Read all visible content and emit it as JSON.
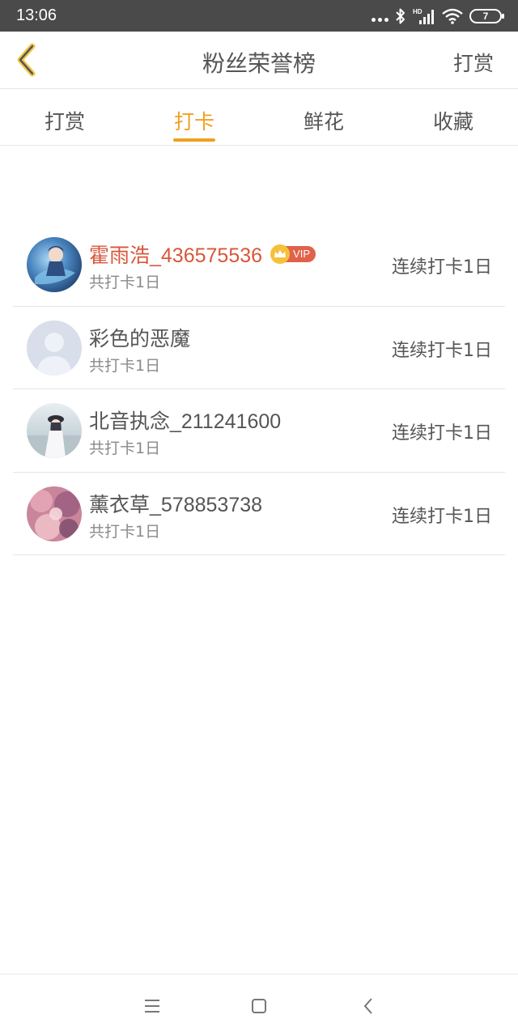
{
  "status_bar": {
    "time": "13:06",
    "battery": "7",
    "icons": [
      "more-dots-icon",
      "bluetooth-icon",
      "signal-hd-icon",
      "wifi-icon",
      "battery-icon"
    ]
  },
  "nav": {
    "title": "粉丝荣誉榜",
    "action_label": "打赏",
    "back_icon": "chevron-left-icon",
    "accent_color": "#f0a020"
  },
  "tabs": [
    {
      "label": "打赏",
      "active": false
    },
    {
      "label": "打卡",
      "active": true
    },
    {
      "label": "鲜花",
      "active": false
    },
    {
      "label": "收藏",
      "active": false
    }
  ],
  "rows": [
    {
      "name": "霍雨浩_436575536",
      "vip": true,
      "vip_label": "VIP",
      "sub": "共打卡1日",
      "streak": "连续打卡1日",
      "avatar": "anime-character-avatar",
      "name_color": "#d9563a"
    },
    {
      "name": "彩色的恶魔",
      "vip": false,
      "sub": "共打卡1日",
      "streak": "连续打卡1日",
      "avatar": "default-user-avatar"
    },
    {
      "name": "北音执念_211241600",
      "vip": false,
      "sub": "共打卡1日",
      "streak": "连续打卡1日",
      "avatar": "girl-photo-avatar"
    },
    {
      "name": "薰衣草_578853738",
      "vip": false,
      "sub": "共打卡1日",
      "streak": "连续打卡1日",
      "avatar": "flower-photo-avatar"
    }
  ],
  "system_nav": {
    "icons": [
      "menu-icon",
      "home-icon",
      "back-icon"
    ]
  }
}
